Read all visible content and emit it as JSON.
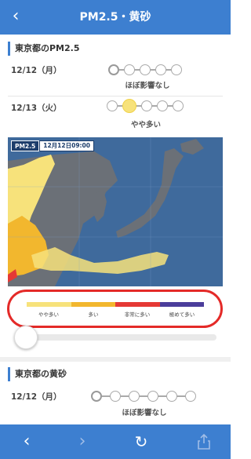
{
  "header": {
    "title": "PM2.5・黄砂",
    "back_icon": "chevron-left-icon"
  },
  "pm25": {
    "title": "東京都のPM2.5",
    "days": [
      {
        "date": "12/12（月）",
        "level_label": "ほぼ影響なし",
        "level": 0
      },
      {
        "date": "12/13（火）",
        "level_label": "やや多い",
        "level": 1
      }
    ]
  },
  "map": {
    "badge": "PM2.5",
    "time": "12月12日09:00"
  },
  "legend": {
    "items": [
      {
        "label": "やや多い",
        "color": "#f7e27b"
      },
      {
        "label": "多い",
        "color": "#f2b72e"
      },
      {
        "label": "非常に多い",
        "color": "#e53935"
      },
      {
        "label": "極めて多い",
        "color": "#4b3d9b"
      }
    ]
  },
  "slider": {
    "position": 0
  },
  "kosa": {
    "title": "東京都の黄砂",
    "days": [
      {
        "date": "12/12（月）",
        "level_label": "ほぼ影響なし",
        "level": 0
      }
    ]
  },
  "toolbar": {
    "back_icon": "back-arrow-icon",
    "forward_icon": "forward-arrow-icon",
    "reload_icon": "reload-icon",
    "share_icon": "share-icon"
  },
  "colors": {
    "accent": "#3d7fd0",
    "highlight": "#e42a28"
  }
}
